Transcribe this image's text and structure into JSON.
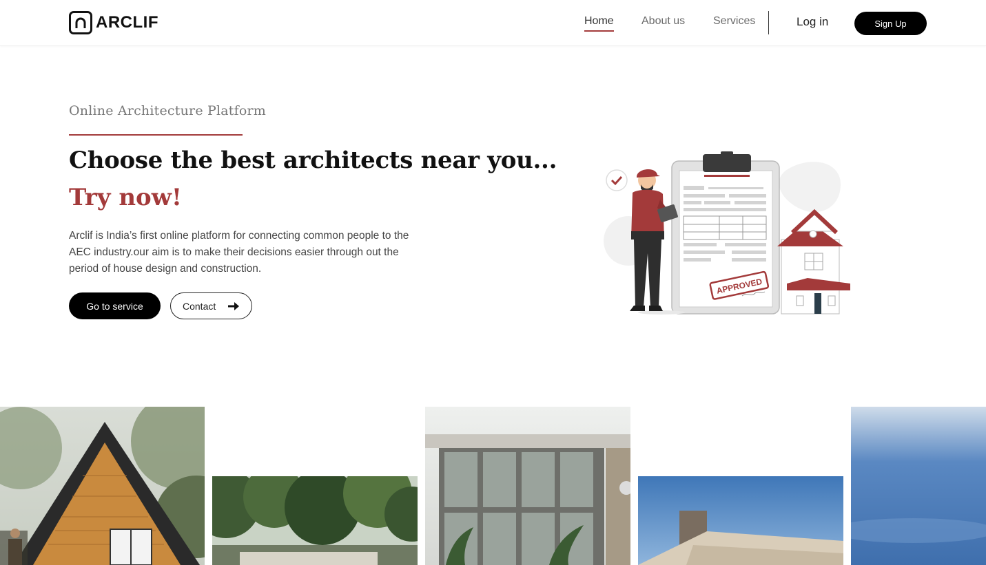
{
  "header": {
    "logo_text": "ARCLIF",
    "nav": [
      {
        "label": "Home",
        "active": true
      },
      {
        "label": "About us",
        "active": false
      },
      {
        "label": "Services",
        "active": false
      }
    ],
    "login_label": "Log in",
    "signup_label": "Sign Up"
  },
  "hero": {
    "eyebrow": "Online Architecture Platform",
    "headline": "Choose the best architects near you...",
    "accent": "Try now!",
    "description": "Arclif is India’s first online platform for connecting common people to the AEC industry.our aim is to make their decisions easier through out the period of house design and construction.",
    "primary_button": "Go to service",
    "secondary_button": "Contact",
    "illustration_stamp": "APPROVED"
  },
  "colors": {
    "accent": "#a33a3a",
    "primary_button_bg": "#000000",
    "text_dark": "#111111"
  },
  "icons": {
    "contact_arrow": "arrow-right-icon",
    "logo": "house-outline-icon"
  },
  "gallery": {
    "cards": [
      {
        "subject": "a-frame-cabin-photo"
      },
      {
        "subject": "forest-villa-photo"
      },
      {
        "subject": "glass-facade-building-photo"
      },
      {
        "subject": "modern-house-sky-photo"
      },
      {
        "subject": "blue-sky-photo"
      }
    ]
  }
}
